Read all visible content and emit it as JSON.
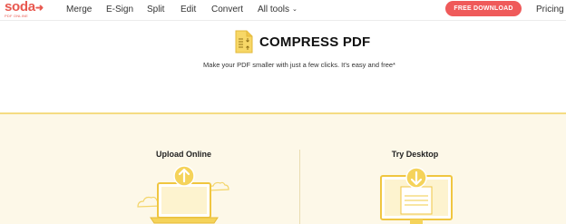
{
  "header": {
    "logo": {
      "name": "soda",
      "tagline": "PDF ONLINE"
    },
    "nav": [
      {
        "label": "Merge"
      },
      {
        "label": "E-Sign"
      },
      {
        "label": "Split"
      },
      {
        "label": "Edit"
      },
      {
        "label": "Convert"
      },
      {
        "label": "All tools"
      }
    ],
    "cta_label": "FREE DOWNLOAD",
    "pricing_label": "Pricing"
  },
  "main": {
    "title": "COMPRESS PDF",
    "subtitle": "Make your PDF smaller with just a few clicks. It's easy and free*"
  },
  "options": {
    "upload_title": "Upload Online",
    "desktop_title": "Try Desktop"
  },
  "colors": {
    "brand": "#e8584f",
    "cta": "#ef5a5a",
    "accent_yellow": "#f5d35a",
    "panel_bg": "#fdf8e8"
  }
}
